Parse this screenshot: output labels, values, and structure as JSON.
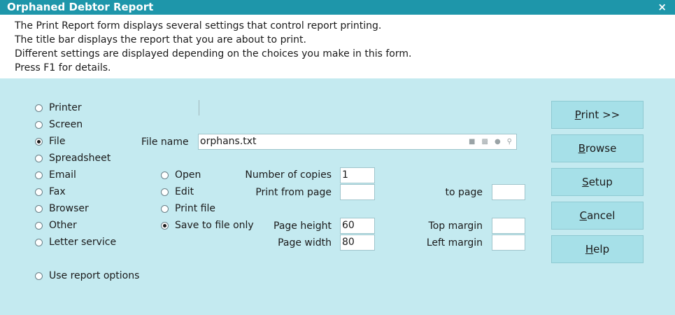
{
  "window": {
    "title": "Orphaned Debtor Report",
    "close_glyph": "×"
  },
  "info_lines": [
    "The Print Report form displays several settings that control report printing.",
    "The title bar displays the report that you are about to print.",
    "Different settings are displayed depending on the choices you make in this form.",
    "Press F1 for details."
  ],
  "destinations": [
    {
      "label": "Printer",
      "selected": false
    },
    {
      "label": "Screen",
      "selected": false
    },
    {
      "label": "File",
      "selected": true
    },
    {
      "label": "Spreadsheet",
      "selected": false
    },
    {
      "label": "Email",
      "selected": false
    },
    {
      "label": "Fax",
      "selected": false
    },
    {
      "label": "Browser",
      "selected": false
    },
    {
      "label": "Other",
      "selected": false
    },
    {
      "label": "Letter service",
      "selected": false
    }
  ],
  "use_report_options": {
    "label": "Use report options",
    "selected": false
  },
  "file_name": {
    "label": "File name",
    "value": "orphans.txt"
  },
  "file_actions": [
    {
      "label": "Open",
      "selected": false
    },
    {
      "label": "Edit",
      "selected": false
    },
    {
      "label": "Print file",
      "selected": false
    },
    {
      "label": "Save to file only",
      "selected": true
    }
  ],
  "settings": {
    "copies": {
      "label": "Number of copies",
      "value": "1"
    },
    "from_page": {
      "label": "Print from page",
      "value": ""
    },
    "to_page": {
      "label": "to page",
      "value": ""
    },
    "page_height": {
      "label": "Page height",
      "value": "60"
    },
    "page_width": {
      "label": "Page width",
      "value": "80"
    },
    "top_margin": {
      "label": "Top margin",
      "value": ""
    },
    "left_margin": {
      "label": "Left margin",
      "value": ""
    }
  },
  "buttons": {
    "print": {
      "hotkey": "P",
      "rest": "rint >>"
    },
    "browse": {
      "hotkey": "B",
      "rest": "rowse"
    },
    "setup": {
      "hotkey": "S",
      "rest": "etup"
    },
    "cancel": {
      "hotkey": "C",
      "rest": "ancel"
    },
    "help": {
      "hotkey": "H",
      "rest": "elp"
    }
  },
  "colors": {
    "title_bar": "#1e96aa",
    "form_background": "#c4eaf0",
    "button_face": "#a6e0e8"
  }
}
